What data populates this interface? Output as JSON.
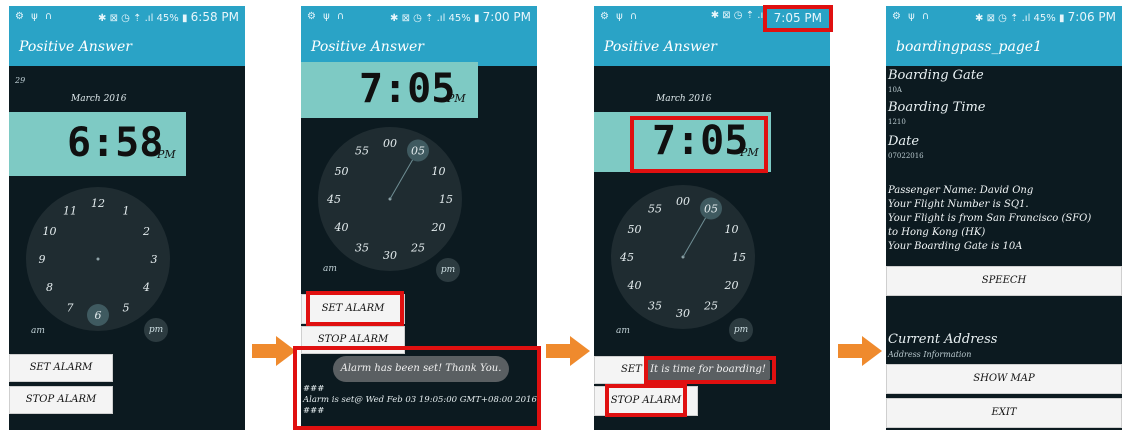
{
  "screen1": {
    "status_left": "⚙ ψ ∩",
    "status_right": "✱ ⊠ ◷ ⇡ .ıl 45% ▮",
    "status_time": "6:58 PM",
    "app_title": "Positive Answer",
    "small_label": "29",
    "month": "March 2016",
    "time": "6:58",
    "ampm": "PM",
    "dial_numbers": [
      "12",
      "1",
      "2",
      "3",
      "4",
      "5",
      "6",
      "7",
      "8",
      "9",
      "10",
      "11"
    ],
    "am_label": "am",
    "pm_label": "pm",
    "set_alarm": "SET ALARM",
    "stop_alarm": "STOP ALARM"
  },
  "screen2": {
    "status_left": "⚙ ψ ∩",
    "status_right": "✱ ⊠ ◷ ⇡ .ıl 45% ▮",
    "status_time": "7:00 PM",
    "app_title": "Positive Answer",
    "time": "7:05",
    "ampm": "PM",
    "dial_numbers": [
      "00",
      "05",
      "10",
      "15",
      "20",
      "25",
      "30",
      "35",
      "40",
      "45",
      "50",
      "55"
    ],
    "am_label": "am",
    "pm_label": "pm",
    "set_alarm": "SET ALARM",
    "stop_alarm": "STOP ALARM",
    "toast": "Alarm has been set! Thank You.",
    "log": "###\nAlarm is set@ Wed Feb 03 19:05:00 GMT+08:00 2016\n###"
  },
  "screen3": {
    "status_left": "⚙ ψ ∩",
    "status_right": "✱ ⊠ ◷ ⇡ .ıl",
    "status_time": "7:05 PM",
    "app_title": "Positive Answer",
    "month": "March 2016",
    "time": "7:05",
    "ampm": "PM",
    "dial_numbers": [
      "00",
      "05",
      "10",
      "15",
      "20",
      "25",
      "30",
      "35",
      "40",
      "45",
      "50",
      "55"
    ],
    "am_label": "am",
    "pm_label": "pm",
    "set_alarm_partial": "SET A",
    "stop_alarm": "STOP ALARM",
    "toast": "It is time for boarding!"
  },
  "screen4": {
    "status_left": "⚙ ψ ∩",
    "status_right": "✱ ⊠ ◷ ⇡ .ıl 45% ▮",
    "status_time": "7:06 PM",
    "app_title": "boardingpass_page1",
    "gate_label": "Boarding Gate",
    "gate_value": "10A",
    "time_label": "Boarding Time",
    "time_value": "1210",
    "date_label": "Date",
    "date_value": "07022016",
    "passenger_lines": [
      "Passenger Name: David Ong",
      "Your Flight Number is SQ1.",
      "Your Flight is from San Francisco (SFO)",
      "to Hong Kong (HK)",
      " Your Boarding Gate is 10A"
    ],
    "speech_button": "SPEECH",
    "address_label": "Current Address",
    "address_info": "Address Information",
    "show_map_button": "SHOW MAP",
    "exit_button": "EXIT"
  },
  "colors": {
    "appbar": "#2aa3c6",
    "screen_bg": "#0c1a20",
    "time_panel": "#7ecac4",
    "highlight": "#e01010",
    "arrow": "#ef8a2d"
  }
}
